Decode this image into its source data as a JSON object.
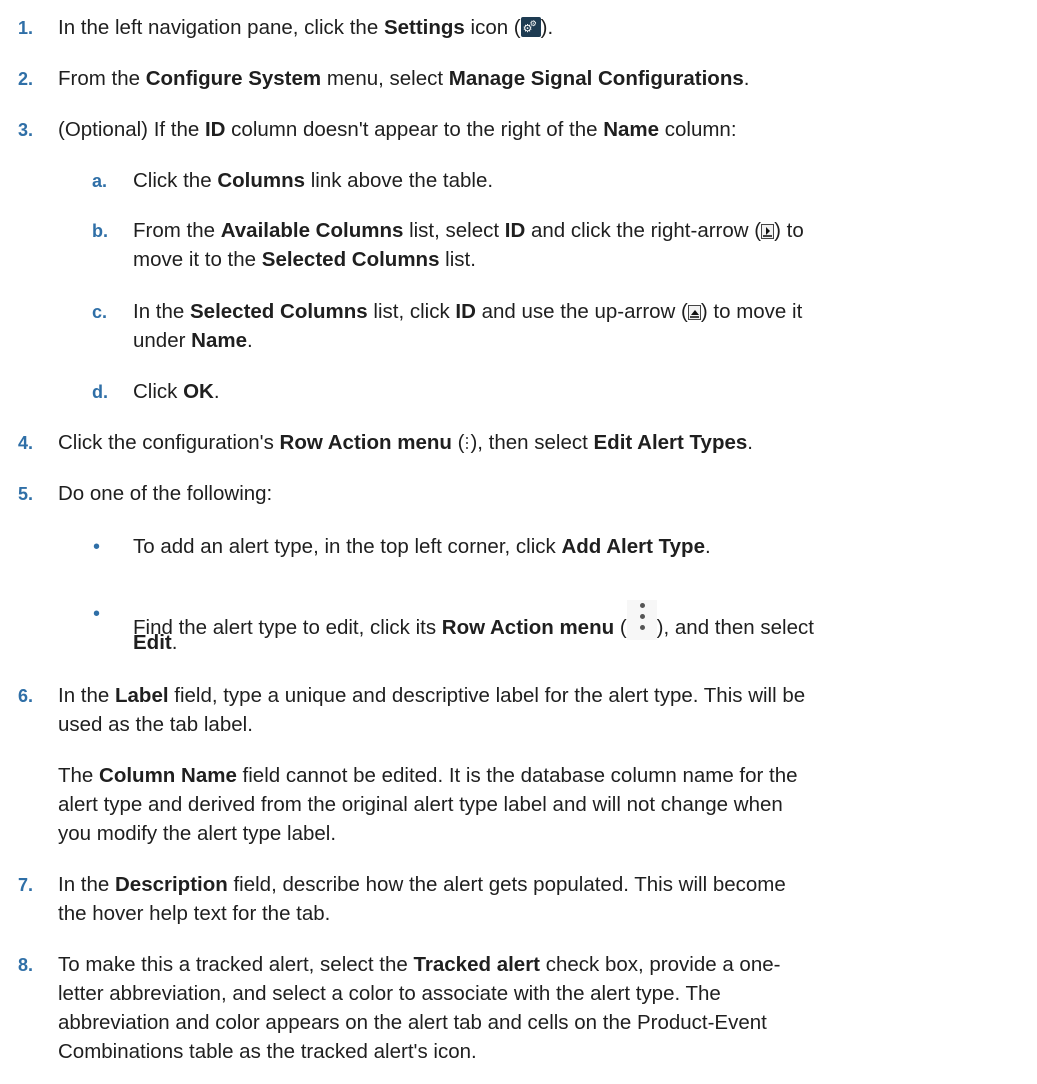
{
  "steps": {
    "s1": {
      "num": "1.",
      "a": "In the left navigation pane, click the ",
      "b": "Settings",
      "c": " icon (",
      "d": ")."
    },
    "s2": {
      "num": "2.",
      "a": "From the ",
      "b": "Configure System",
      "c": " menu, select ",
      "d": "Manage Signal Configurations",
      "e": "."
    },
    "s3": {
      "num": "3.",
      "a": "(Optional) If the ",
      "b": "ID",
      "c": " column doesn't appear to the right of the ",
      "d": "Name",
      "e": " column:"
    },
    "s3a": {
      "num": "a.",
      "a": "Click the ",
      "b": "Columns",
      "c": " link above the table."
    },
    "s3b": {
      "num": "b.",
      "l1a": "From the ",
      "l1b": "Available Columns",
      "l1c": " list, select ",
      "l1d": "ID",
      "l1e": " and click the right-arrow (",
      "l1f": ") to",
      "l2a": "move it to the ",
      "l2b": "Selected Columns",
      "l2c": " list."
    },
    "s3c": {
      "num": "c.",
      "l1a": "In the ",
      "l1b": "Selected Columns",
      "l1c": " list, click ",
      "l1d": "ID",
      "l1e": " and use the up-arrow (",
      "l1f": ") to move it",
      "l2a": "under ",
      "l2b": "Name",
      "l2c": "."
    },
    "s3d": {
      "num": "d.",
      "a": "Click ",
      "b": "OK",
      "c": "."
    },
    "s4": {
      "num": "4.",
      "a": "Click the configuration's ",
      "b": "Row Action menu",
      "c": " (",
      "d": "), then select ",
      "e": "Edit Alert Types",
      "f": "."
    },
    "s5": {
      "num": "5.",
      "a": "Do one of the following:"
    },
    "s5b1": {
      "bullet": "•",
      "a": "To add an alert type, in the top left corner, click ",
      "b": "Add Alert Type",
      "c": "."
    },
    "s5b2": {
      "bullet": "•",
      "l1a": "Find the alert type to edit, click its ",
      "l1b": "Row Action menu",
      "l1c": " (",
      "l1d": "), and then select",
      "l2a": "Edit",
      "l2b": "."
    },
    "s6": {
      "num": "6.",
      "l1a": "In the ",
      "l1b": "Label",
      "l1c": " field, type a unique and descriptive label for the alert type. This will be",
      "l2": "used as the tab label.",
      "p1a": "The ",
      "p1b": "Column Name",
      "p1c": " field cannot be edited. It is the database column name for the",
      "p2": "alert type and derived from the original alert type label and will not change when",
      "p3": "you modify the alert type label."
    },
    "s7": {
      "num": "7.",
      "l1a": "In the ",
      "l1b": "Description",
      "l1c": " field, describe how the alert gets populated. This will become",
      "l2": "the hover help text for the tab."
    },
    "s8": {
      "num": "8.",
      "l1a": "To make this a tracked alert, select the ",
      "l1b": "Tracked alert",
      "l1c": " check box, provide a one-",
      "l2": "letter abbreviation, and select a color to associate with the alert type. The",
      "l3": "abbreviation and color appears on the alert tab and cells on the Product-Event",
      "l4": "Combinations table as the tracked alert's icon."
    }
  },
  "icons": {
    "settings": "settings-gears-icon",
    "right_arrow": "right-arrow-button-icon",
    "up_arrow": "up-arrow-button-icon",
    "row_action_small": "kebab-menu-icon",
    "row_action_large": "kebab-menu-icon"
  },
  "colors": {
    "step_number": "#2f6fa7",
    "text": "#1f1f1f",
    "settings_icon_bg": "#1d3b52"
  }
}
